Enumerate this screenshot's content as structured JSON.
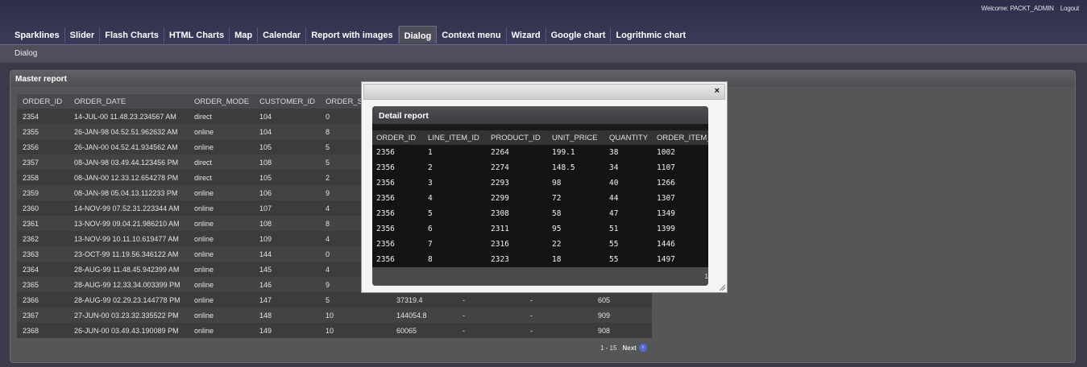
{
  "header": {
    "welcome": "Welcome: PACKT_ADMIN",
    "logout": "Logout"
  },
  "tabs": [
    "Sparklines",
    "Slider",
    "Flash Charts",
    "HTML Charts",
    "Map",
    "Calendar",
    "Report with images",
    "Dialog",
    "Context menu",
    "Wizard",
    "Google chart",
    "Logrithmic chart"
  ],
  "active_tab": "Dialog",
  "breadcrumb": "Dialog",
  "master": {
    "title": "Master report",
    "columns": [
      "ORDER_ID",
      "ORDER_DATE",
      "ORDER_MODE",
      "CUSTOMER_ID",
      "ORDER_S",
      "",
      "",
      "",
      ""
    ],
    "rows": [
      [
        "2354",
        "14-JUL-00 11.48.23.234567 AM",
        "direct",
        "104",
        "0",
        "",
        "",
        "",
        ""
      ],
      [
        "2355",
        "26-JAN-98 04.52.51.962632 AM",
        "online",
        "104",
        "8",
        "",
        "",
        "",
        ""
      ],
      [
        "2356",
        "26-JAN-00 04.52.41.934562 AM",
        "online",
        "105",
        "5",
        "",
        "",
        "",
        ""
      ],
      [
        "2357",
        "08-JAN-98 03.49.44.123456 PM",
        "direct",
        "108",
        "5",
        "",
        "",
        "",
        ""
      ],
      [
        "2358",
        "08-JAN-00 12.33.12.654278 PM",
        "direct",
        "105",
        "2",
        "",
        "",
        "",
        ""
      ],
      [
        "2359",
        "08-JAN-98 05.04.13.112233 PM",
        "online",
        "106",
        "9",
        "",
        "",
        "",
        ""
      ],
      [
        "2360",
        "14-NOV-99 07.52.31.223344 AM",
        "online",
        "107",
        "4",
        "",
        "",
        "",
        ""
      ],
      [
        "2361",
        "13-NOV-99 09.04.21.986210 AM",
        "online",
        "108",
        "8",
        "",
        "",
        "",
        ""
      ],
      [
        "2362",
        "13-NOV-99 10.11.10.619477 AM",
        "online",
        "109",
        "4",
        "",
        "",
        "",
        ""
      ],
      [
        "2363",
        "23-OCT-99 11.19.56.346122 AM",
        "online",
        "144",
        "0",
        "",
        "",
        "",
        ""
      ],
      [
        "2364",
        "28-AUG-99 11.48.45.942399 AM",
        "online",
        "145",
        "4",
        "",
        "",
        "",
        ""
      ],
      [
        "2365",
        "28-AUG-99 12.33.34.003399 PM",
        "online",
        "146",
        "9",
        "",
        "",
        "",
        ""
      ],
      [
        "2366",
        "28-AUG-99 02.29.23.144778 PM",
        "online",
        "147",
        "5",
        "37319.4",
        "-",
        "-",
        "605"
      ],
      [
        "2367",
        "27-JUN-00 03.23.32.335522 PM",
        "online",
        "148",
        "10",
        "144054.8",
        "-",
        "-",
        "909"
      ],
      [
        "2368",
        "26-JUN-00 03.49.43.190089 PM",
        "online",
        "149",
        "10",
        "60065",
        "-",
        "-",
        "908"
      ]
    ],
    "pager": {
      "range": "1 - 15",
      "next": "Next"
    }
  },
  "dialog": {
    "close": "×",
    "detail": {
      "title": "Detail report",
      "columns": [
        "ORDER_ID",
        "LINE_ITEM_ID",
        "PRODUCT_ID",
        "UNIT_PRICE",
        "QUANTITY",
        "ORDER_ITEM_"
      ],
      "rows": [
        [
          "2356",
          "1",
          "2264",
          "199.1",
          "38",
          "1002"
        ],
        [
          "2356",
          "2",
          "2274",
          "148.5",
          "34",
          "1107"
        ],
        [
          "2356",
          "3",
          "2293",
          "98",
          "40",
          "1266"
        ],
        [
          "2356",
          "4",
          "2299",
          "72",
          "44",
          "1307"
        ],
        [
          "2356",
          "5",
          "2308",
          "58",
          "47",
          "1349"
        ],
        [
          "2356",
          "6",
          "2311",
          "95",
          "51",
          "1399"
        ],
        [
          "2356",
          "7",
          "2316",
          "22",
          "55",
          "1446"
        ],
        [
          "2356",
          "8",
          "2323",
          "18",
          "55",
          "1497"
        ]
      ],
      "footer_num": "1"
    }
  }
}
